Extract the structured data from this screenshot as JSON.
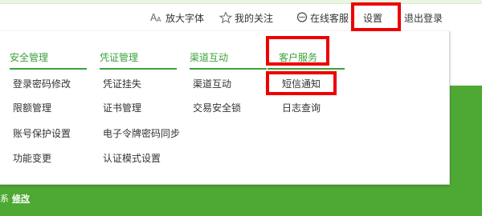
{
  "topbar": {
    "font_size_label": "放大字体",
    "font_size_icon": "font-size-icon",
    "favorites_label": "我的关注",
    "favorites_icon": "star-outline-icon",
    "online_service_label": "在线客服",
    "online_service_icon": "chat-bubble-icon",
    "settings_label": "设置",
    "logout_label": "退出登录"
  },
  "menu": {
    "columns": [
      {
        "title": "安全管理",
        "items": [
          "登录密码修改",
          "限额管理",
          "账号保护设置",
          "功能变更"
        ]
      },
      {
        "title": "凭证管理",
        "items": [
          "凭证挂失",
          "证书管理",
          "电子令牌密码同步",
          "认证模式设置"
        ]
      },
      {
        "title": "渠道互动",
        "items": [
          "渠道互动",
          "交易安全锁"
        ]
      },
      {
        "title": "客户服务",
        "items": [
          "短信通知",
          "日志查询"
        ]
      }
    ]
  },
  "bottom": {
    "prefix": "系",
    "link": "修改"
  },
  "colors": {
    "brand_green": "#4ea834",
    "title_green": "#3aa23a",
    "highlight_red": "#ee0000"
  }
}
